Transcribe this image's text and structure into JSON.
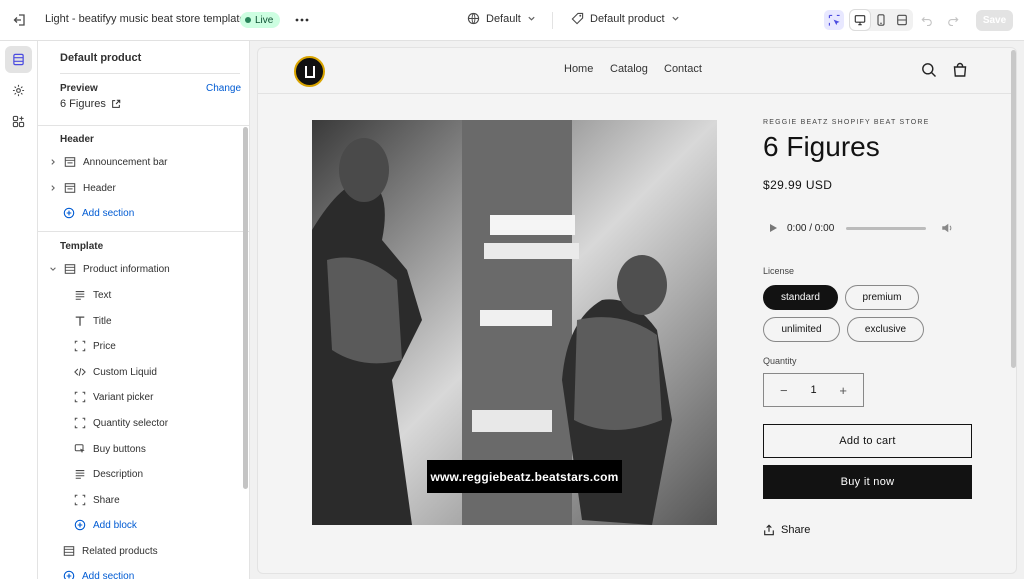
{
  "topbar": {
    "theme_name": "Light - beatifyy music beat store template",
    "live_badge": "Live",
    "context_select": "Default",
    "page_select": "Default product",
    "save_label": "Save"
  },
  "sidebar": {
    "title": "Default product",
    "preview_label": "Preview",
    "change_label": "Change",
    "preview_value": "6 Figures",
    "header_group": {
      "heading": "Header",
      "items": [
        "Announcement bar",
        "Header"
      ],
      "add_section": "Add section"
    },
    "template_group": {
      "heading": "Template",
      "section": "Product information",
      "blocks": [
        "Text",
        "Title",
        "Price",
        "Custom Liquid",
        "Variant picker",
        "Quantity selector",
        "Buy buttons",
        "Description",
        "Share"
      ],
      "add_block": "Add block",
      "related": "Related products",
      "add_section": "Add section"
    }
  },
  "store": {
    "nav": [
      "Home",
      "Catalog",
      "Contact"
    ],
    "image_watermark": "www.reggiebeatz.beatstars.com",
    "vendor": "REGGIE BEATZ SHOPIFY BEAT STORE",
    "product_title": "6 Figures",
    "price": "$29.99 USD",
    "audio_time": "0:00 / 0:00",
    "license_label": "License",
    "license_options": [
      "standard",
      "premium",
      "unlimited",
      "exclusive"
    ],
    "selected_license": "standard",
    "quantity_label": "Quantity",
    "quantity_value": "1",
    "qty_minus": "−",
    "qty_plus": "+",
    "add_to_cart": "Add to cart",
    "buy_now": "Buy it now",
    "share": "Share"
  },
  "icons": [
    "exit-icon",
    "more-icon",
    "globe-icon",
    "tag-icon",
    "chevron-down-icon",
    "inspector-icon",
    "desktop-icon",
    "mobile-icon",
    "fullscreen-icon",
    "undo-icon",
    "redo-icon",
    "sections-icon",
    "settings-icon",
    "apps-icon",
    "external-link-icon",
    "chevron-right-icon",
    "plus-circle-icon",
    "search-icon",
    "cart-icon",
    "play-icon",
    "volume-icon",
    "share-icon"
  ],
  "colors": {
    "live_badge_bg": "#cdfee1",
    "link_blue": "#005bd3",
    "selected_pill": "#121212",
    "buy_button": "#121212"
  }
}
